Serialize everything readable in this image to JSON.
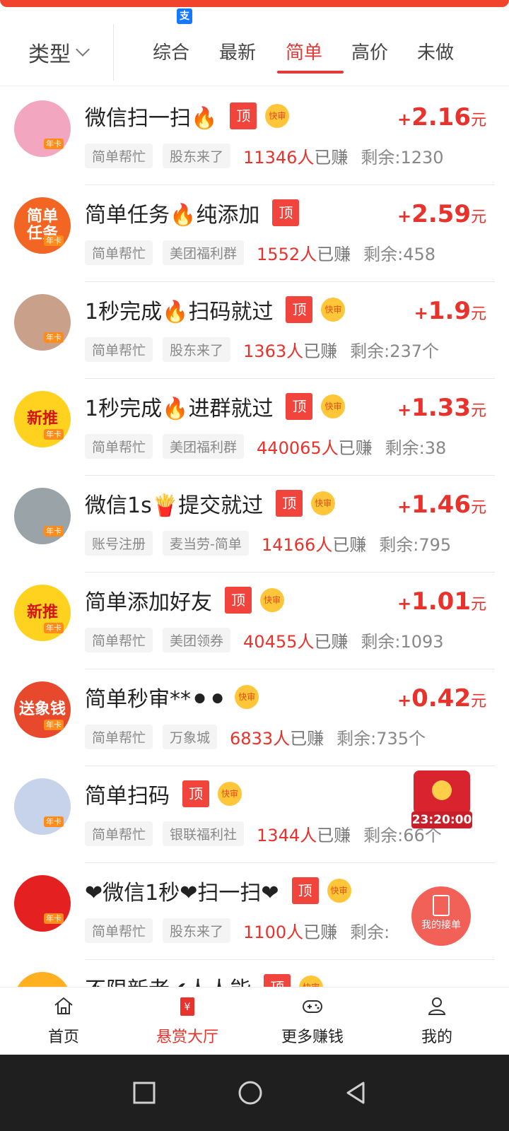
{
  "filter_bar": {
    "type_label": "类型",
    "tabs": [
      "综合",
      "最新",
      "简单",
      "高价",
      "未做"
    ],
    "active_tab": "简单"
  },
  "tasks": [
    {
      "title": "微信扫一扫🔥",
      "top": true,
      "fast": true,
      "avatar_text": "",
      "avatar_color": "#f3a6c0",
      "price": "2.16",
      "tags": [
        "简单帮忙",
        "股东来了"
      ],
      "earned": "11346人",
      "remaining": "剩余:1230"
    },
    {
      "title": "简单任务🔥纯添加",
      "top": true,
      "fast": false,
      "avatar_text": "简单\n任务",
      "avatar_color": "#f26522",
      "price": "2.59",
      "tags": [
        "简单帮忙",
        "美团福利群"
      ],
      "earned": "1552人",
      "remaining": "剩余:458"
    },
    {
      "title": "1秒完成🔥扫码就过",
      "top": true,
      "fast": true,
      "avatar_text": "",
      "avatar_color": "#c9a08a",
      "price": "1.9",
      "tags": [
        "简单帮忙",
        "股东来了"
      ],
      "earned": "1363人",
      "remaining": "剩余:237个"
    },
    {
      "title": "1秒完成🔥进群就过",
      "top": true,
      "fast": true,
      "avatar_text": "新推",
      "avatar_color": "#ffd21f",
      "price": "1.33",
      "tags": [
        "简单帮忙",
        "美团福利群"
      ],
      "earned": "440065人",
      "remaining": "剩余:38"
    },
    {
      "title": "微信1s🍟提交就过",
      "top": true,
      "fast": true,
      "avatar_text": "",
      "avatar_color": "#9aa3a8",
      "price": "1.46",
      "tags": [
        "账号注册",
        "麦当劳-简单"
      ],
      "earned": "14166人",
      "remaining": "剩余:795"
    },
    {
      "title": "简单添加好友",
      "top": true,
      "fast": true,
      "avatar_text": "新推",
      "avatar_color": "#ffd21f",
      "price": "1.01",
      "tags": [
        "简单帮忙",
        "美团领券"
      ],
      "earned": "40455人",
      "remaining": "剩余:1093"
    },
    {
      "title": "简单秒审**⚫⚫",
      "top": false,
      "fast": true,
      "avatar_text": "送象钱",
      "avatar_color": "#e8482c",
      "price": "0.42",
      "tags": [
        "简单帮忙",
        "万象城"
      ],
      "earned": "6833人",
      "remaining": "剩余:735个"
    },
    {
      "title": "简单扫码",
      "top": true,
      "fast": true,
      "avatar_text": "",
      "avatar_color": "#c7d3ea",
      "price": "",
      "tags": [
        "简单帮忙",
        "银联福利社"
      ],
      "earned": "1344人",
      "remaining": "剩余:66个"
    },
    {
      "title": "❤微信1秒❤扫一扫❤",
      "top": true,
      "fast": true,
      "avatar_text": "",
      "avatar_color": "#e52020",
      "price": "",
      "tags": [
        "简单帮忙",
        "股东来了"
      ],
      "earned": "1100人",
      "remaining": "剩余:"
    },
    {
      "title": "不限新老✔人人能",
      "top": true,
      "fast": true,
      "avatar_text": "",
      "avatar_color": "#ffb020",
      "price": "",
      "tags": [],
      "earned": "",
      "remaining": ""
    }
  ],
  "price_prefix": "+",
  "price_unit": "元",
  "top_badge": "顶",
  "fast_badge": "快审",
  "card_badge": "年卡",
  "earned_suffix": "已赚",
  "floating": {
    "timer": "23:20:00",
    "orders_label": "我的接单"
  },
  "bottom_nav": [
    {
      "label": "首页",
      "icon": "home-icon"
    },
    {
      "label": "悬赏大厅",
      "icon": "reward-hall-icon"
    },
    {
      "label": "更多赚钱",
      "icon": "gamepad-icon"
    },
    {
      "label": "我的",
      "icon": "user-icon"
    }
  ],
  "active_nav": "悬赏大厅"
}
